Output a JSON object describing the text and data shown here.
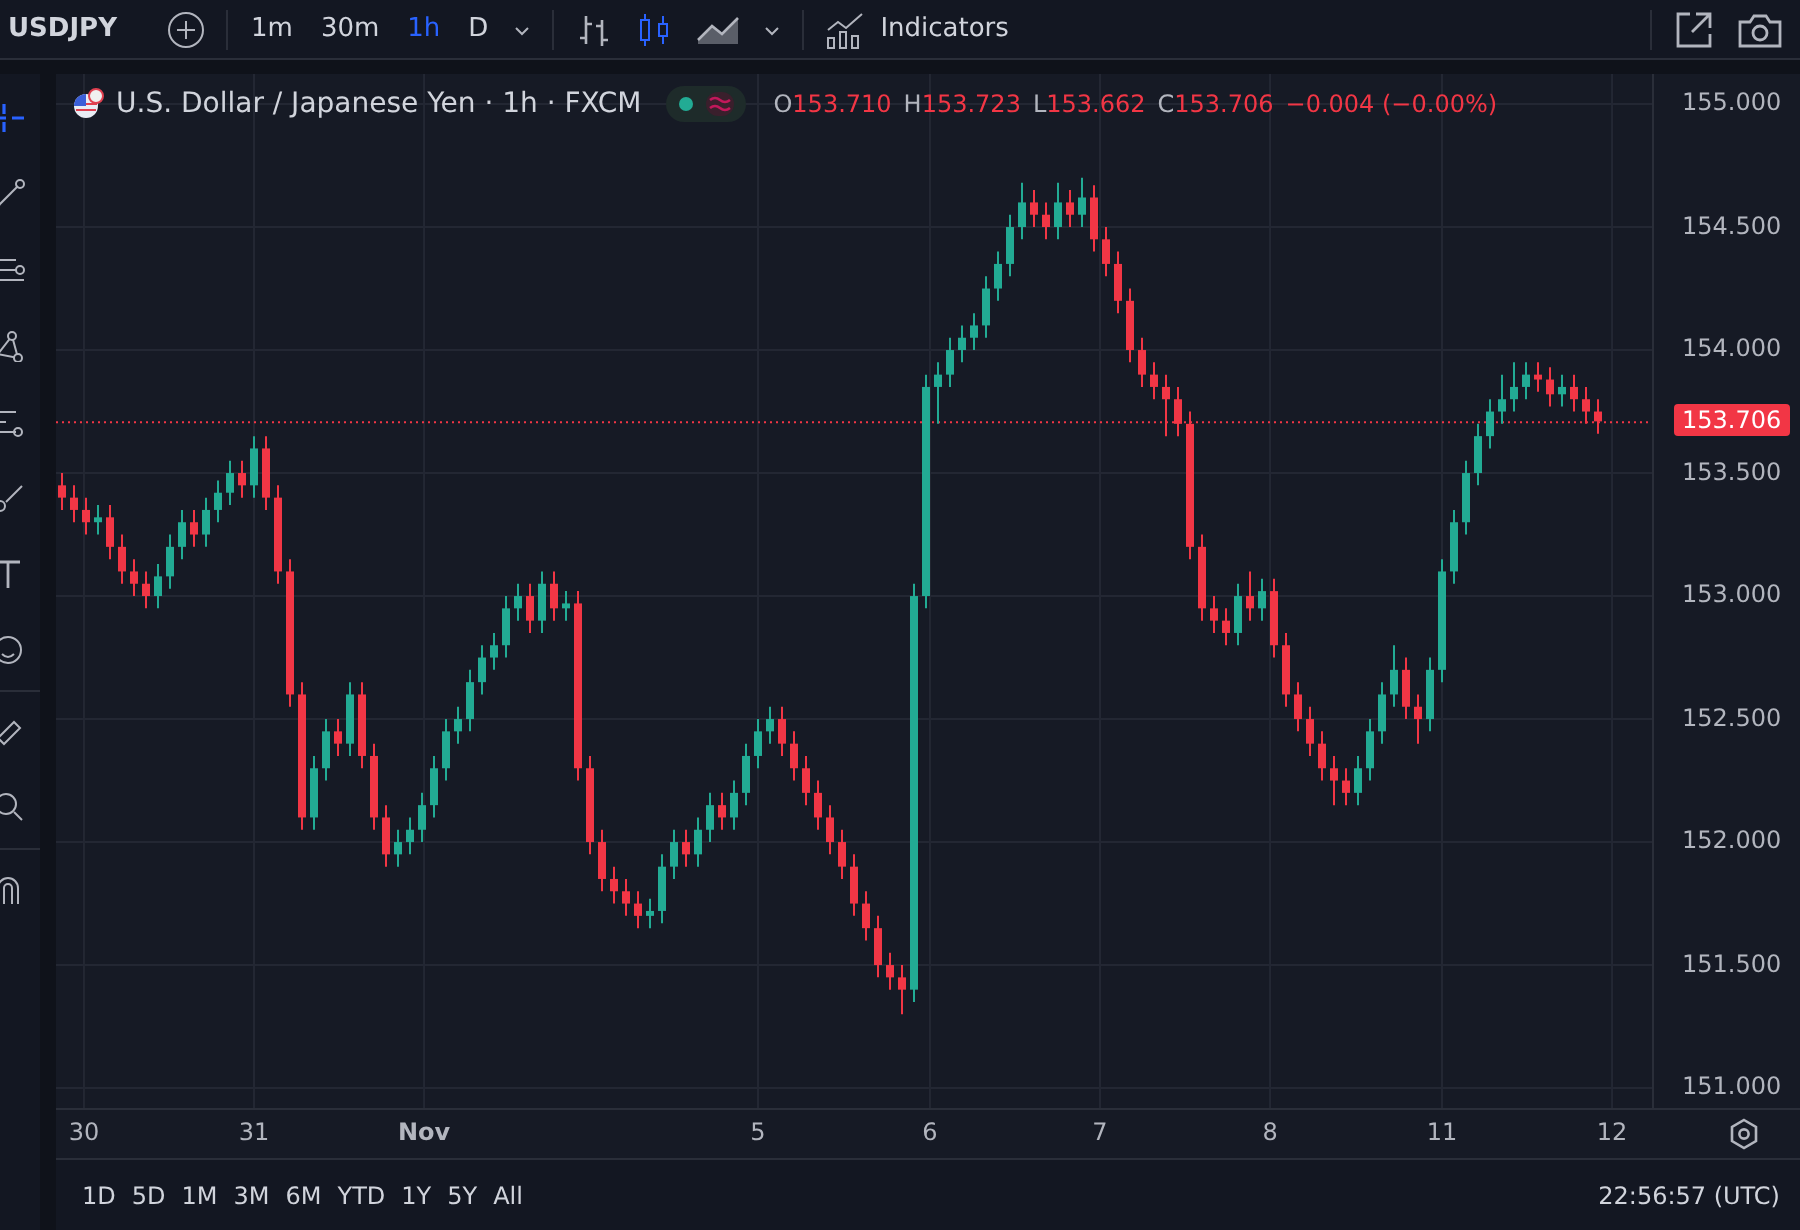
{
  "toolbar": {
    "symbol": "USDJPY",
    "intervals": [
      {
        "label": "1m",
        "selected": false
      },
      {
        "label": "30m",
        "selected": false
      },
      {
        "label": "1h",
        "selected": true
      },
      {
        "label": "D",
        "selected": false
      }
    ],
    "chart_types": [
      {
        "kind": "bars",
        "selected": false
      },
      {
        "kind": "candles",
        "selected": true
      },
      {
        "kind": "area",
        "selected": false
      }
    ],
    "indicators": "Indicators"
  },
  "legend": {
    "title": "U.S. Dollar / Japanese Yen · 1h · FXCM",
    "ohlc": [
      {
        "label": "O",
        "value": "153.710"
      },
      {
        "label": "H",
        "value": "153.723"
      },
      {
        "label": "L",
        "value": "153.662"
      },
      {
        "label": "C",
        "value": "153.706"
      }
    ],
    "change": "−0.004 (−0.00%)"
  },
  "chart": {
    "time_labels": [
      "30",
      "31",
      "Nov",
      "5",
      "6",
      "7",
      "8",
      "11",
      "12"
    ],
    "chart_data": {
      "type": "candlestick",
      "grid": true,
      "ylim": [
        150.919,
        155.122
      ],
      "ref_lines": [
        {
          "axis": "y",
          "value": 153.706,
          "label": "153.706",
          "color": "#f23645"
        }
      ],
      "yticks": [
        {
          "value": 155,
          "label": "155.000"
        },
        {
          "value": 154.5,
          "label": "154.500"
        },
        {
          "value": 154,
          "label": "154.000"
        },
        {
          "value": 153.5,
          "label": "153.500"
        },
        {
          "value": 153,
          "label": "153.000"
        },
        {
          "value": 152.5,
          "label": "152.500"
        },
        {
          "value": 152,
          "label": "152.000"
        },
        {
          "value": 151.5,
          "label": "151.500"
        },
        {
          "value": 151,
          "label": "151.000"
        }
      ],
      "ohlc": [
        [
          153.45,
          153.5,
          153.35,
          153.4
        ],
        [
          153.4,
          153.45,
          153.3,
          153.35
        ],
        [
          153.35,
          153.4,
          153.25,
          153.3
        ],
        [
          153.3,
          153.37,
          153.25,
          153.32
        ],
        [
          153.32,
          153.37,
          153.15,
          153.2
        ],
        [
          153.2,
          153.25,
          153.05,
          153.1
        ],
        [
          153.1,
          153.15,
          153.0,
          153.05
        ],
        [
          153.05,
          153.1,
          152.95,
          153.0
        ],
        [
          153.0,
          153.13,
          152.95,
          153.08
        ],
        [
          153.08,
          153.25,
          153.03,
          153.2
        ],
        [
          153.2,
          153.35,
          153.15,
          153.3
        ],
        [
          153.3,
          153.35,
          153.2,
          153.25
        ],
        [
          153.25,
          153.4,
          153.2,
          153.35
        ],
        [
          153.35,
          153.47,
          153.3,
          153.42
        ],
        [
          153.42,
          153.55,
          153.37,
          153.5
        ],
        [
          153.5,
          153.55,
          153.4,
          153.45
        ],
        [
          153.45,
          153.65,
          153.4,
          153.6
        ],
        [
          153.6,
          153.65,
          153.35,
          153.4
        ],
        [
          153.4,
          153.45,
          153.05,
          153.1
        ],
        [
          153.1,
          153.15,
          152.55,
          152.6
        ],
        [
          152.6,
          152.65,
          152.05,
          152.1
        ],
        [
          152.1,
          152.35,
          152.05,
          152.3
        ],
        [
          152.3,
          152.5,
          152.25,
          152.45
        ],
        [
          152.45,
          152.5,
          152.35,
          152.4
        ],
        [
          152.4,
          152.65,
          152.35,
          152.6
        ],
        [
          152.6,
          152.65,
          152.3,
          152.35
        ],
        [
          152.35,
          152.4,
          152.05,
          152.1
        ],
        [
          152.1,
          152.15,
          151.9,
          151.95
        ],
        [
          151.95,
          152.05,
          151.9,
          152.0
        ],
        [
          152.0,
          152.1,
          151.95,
          152.05
        ],
        [
          152.05,
          152.2,
          152.0,
          152.15
        ],
        [
          152.15,
          152.35,
          152.1,
          152.3
        ],
        [
          152.3,
          152.5,
          152.25,
          152.45
        ],
        [
          152.45,
          152.55,
          152.4,
          152.5
        ],
        [
          152.5,
          152.7,
          152.45,
          152.65
        ],
        [
          152.65,
          152.8,
          152.6,
          152.75
        ],
        [
          152.75,
          152.85,
          152.7,
          152.8
        ],
        [
          152.8,
          153.0,
          152.75,
          152.95
        ],
        [
          152.95,
          153.05,
          152.9,
          153.0
        ],
        [
          153.0,
          153.05,
          152.85,
          152.9
        ],
        [
          152.9,
          153.1,
          152.85,
          153.05
        ],
        [
          153.05,
          153.1,
          152.9,
          152.95
        ],
        [
          152.95,
          153.02,
          152.9,
          152.97
        ],
        [
          152.97,
          153.02,
          152.25,
          152.3
        ],
        [
          152.3,
          152.35,
          151.95,
          152.0
        ],
        [
          152.0,
          152.05,
          151.8,
          151.85
        ],
        [
          151.85,
          151.9,
          151.75,
          151.8
        ],
        [
          151.8,
          151.85,
          151.7,
          151.75
        ],
        [
          151.75,
          151.8,
          151.65,
          151.7
        ],
        [
          151.7,
          151.77,
          151.65,
          151.72
        ],
        [
          151.72,
          151.95,
          151.67,
          151.9
        ],
        [
          151.9,
          152.05,
          151.85,
          152.0
        ],
        [
          152.0,
          152.05,
          151.9,
          151.95
        ],
        [
          151.95,
          152.1,
          151.9,
          152.05
        ],
        [
          152.05,
          152.2,
          152.0,
          152.15
        ],
        [
          152.15,
          152.2,
          152.05,
          152.1
        ],
        [
          152.1,
          152.25,
          152.05,
          152.2
        ],
        [
          152.2,
          152.4,
          152.15,
          152.35
        ],
        [
          152.35,
          152.5,
          152.3,
          152.45
        ],
        [
          152.45,
          152.55,
          152.4,
          152.5
        ],
        [
          152.5,
          152.55,
          152.35,
          152.4
        ],
        [
          152.4,
          152.45,
          152.25,
          152.3
        ],
        [
          152.3,
          152.35,
          152.15,
          152.2
        ],
        [
          152.2,
          152.25,
          152.05,
          152.1
        ],
        [
          152.1,
          152.15,
          151.95,
          152.0
        ],
        [
          152.0,
          152.05,
          151.85,
          151.9
        ],
        [
          151.9,
          151.95,
          151.7,
          151.75
        ],
        [
          151.75,
          151.8,
          151.6,
          151.65
        ],
        [
          151.65,
          151.7,
          151.45,
          151.5
        ],
        [
          151.5,
          151.55,
          151.4,
          151.45
        ],
        [
          151.45,
          151.5,
          151.3,
          151.4
        ],
        [
          151.4,
          153.05,
          151.35,
          153.0
        ],
        [
          153.0,
          153.9,
          152.95,
          153.85
        ],
        [
          153.85,
          153.95,
          153.7,
          153.9
        ],
        [
          153.9,
          154.05,
          153.85,
          154.0
        ],
        [
          154.0,
          154.1,
          153.95,
          154.05
        ],
        [
          154.05,
          154.15,
          154.0,
          154.1
        ],
        [
          154.1,
          154.3,
          154.05,
          154.25
        ],
        [
          154.25,
          154.4,
          154.2,
          154.35
        ],
        [
          154.35,
          154.55,
          154.3,
          154.5
        ],
        [
          154.5,
          154.68,
          154.45,
          154.6
        ],
        [
          154.6,
          154.65,
          154.5,
          154.55
        ],
        [
          154.55,
          154.6,
          154.45,
          154.5
        ],
        [
          154.5,
          154.68,
          154.45,
          154.6
        ],
        [
          154.6,
          154.65,
          154.5,
          154.55
        ],
        [
          154.55,
          154.7,
          154.5,
          154.62
        ],
        [
          154.62,
          154.67,
          154.4,
          154.45
        ],
        [
          154.45,
          154.5,
          154.3,
          154.35
        ],
        [
          154.35,
          154.4,
          154.15,
          154.2
        ],
        [
          154.2,
          154.25,
          153.95,
          154.0
        ],
        [
          154.0,
          154.05,
          153.85,
          153.9
        ],
        [
          153.9,
          153.95,
          153.8,
          153.85
        ],
        [
          153.85,
          153.9,
          153.65,
          153.8
        ],
        [
          153.8,
          153.85,
          153.65,
          153.7
        ],
        [
          153.7,
          153.75,
          153.15,
          153.2
        ],
        [
          153.2,
          153.25,
          152.9,
          152.95
        ],
        [
          152.95,
          153.0,
          152.85,
          152.9
        ],
        [
          152.9,
          152.95,
          152.8,
          152.85
        ],
        [
          152.85,
          153.05,
          152.8,
          153.0
        ],
        [
          153.0,
          153.1,
          152.9,
          152.95
        ],
        [
          152.95,
          153.07,
          152.9,
          153.02
        ],
        [
          153.02,
          153.07,
          152.75,
          152.8
        ],
        [
          152.8,
          152.85,
          152.55,
          152.6
        ],
        [
          152.6,
          152.65,
          152.45,
          152.5
        ],
        [
          152.5,
          152.55,
          152.35,
          152.4
        ],
        [
          152.4,
          152.45,
          152.25,
          152.3
        ],
        [
          152.3,
          152.35,
          152.15,
          152.25
        ],
        [
          152.25,
          152.3,
          152.15,
          152.2
        ],
        [
          152.2,
          152.35,
          152.15,
          152.3
        ],
        [
          152.3,
          152.5,
          152.25,
          152.45
        ],
        [
          152.45,
          152.65,
          152.4,
          152.6
        ],
        [
          152.6,
          152.8,
          152.55,
          152.7
        ],
        [
          152.7,
          152.75,
          152.5,
          152.55
        ],
        [
          152.55,
          152.6,
          152.4,
          152.5
        ],
        [
          152.5,
          152.75,
          152.45,
          152.7
        ],
        [
          152.7,
          153.15,
          152.65,
          153.1
        ],
        [
          153.1,
          153.35,
          153.05,
          153.3
        ],
        [
          153.3,
          153.55,
          153.25,
          153.5
        ],
        [
          153.5,
          153.7,
          153.45,
          153.65
        ],
        [
          153.65,
          153.8,
          153.6,
          153.75
        ],
        [
          153.75,
          153.9,
          153.7,
          153.8
        ],
        [
          153.8,
          153.95,
          153.75,
          153.85
        ],
        [
          153.85,
          153.95,
          153.8,
          153.9
        ],
        [
          153.9,
          153.95,
          153.83,
          153.88
        ],
        [
          153.88,
          153.93,
          153.77,
          153.82
        ],
        [
          153.82,
          153.9,
          153.77,
          153.85
        ],
        [
          153.85,
          153.9,
          153.75,
          153.8
        ],
        [
          153.8,
          153.85,
          153.7,
          153.75
        ],
        [
          153.75,
          153.8,
          153.66,
          153.71
        ]
      ]
    }
  },
  "ranges": [
    "1D",
    "5D",
    "1M",
    "3M",
    "6M",
    "YTD",
    "1Y",
    "5Y",
    "All"
  ],
  "clock": "22:56:57 (UTC)"
}
